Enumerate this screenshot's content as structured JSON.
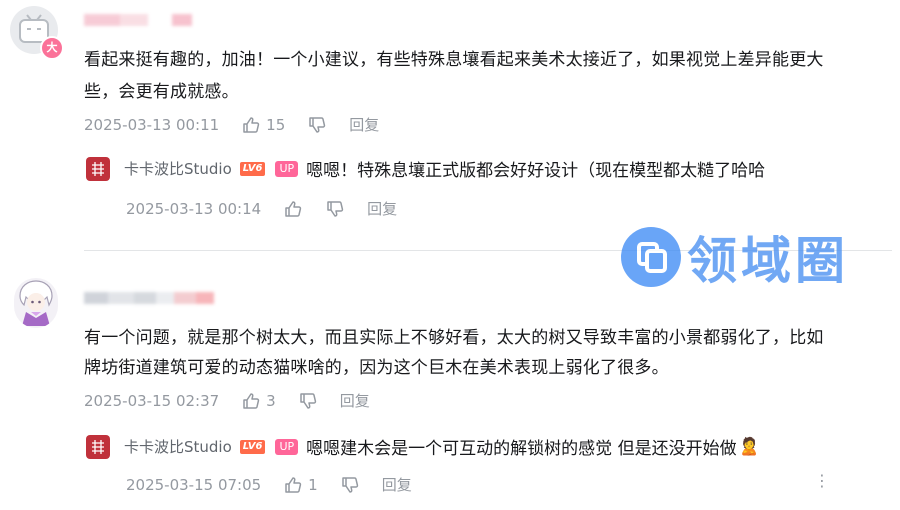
{
  "comments": [
    {
      "text_line1": "看起来挺有趣的，加油！一个小建议，有些特殊息壤看起来美术太接近了，如果视觉上差异能更大",
      "text_line2": "些，会更有成就感。",
      "time": "2025-03-13 00:11",
      "likes": "15",
      "reply_label": "回复",
      "avatar_badge": "大",
      "reply": {
        "author": "卡卡波比Studio",
        "level": "LV6",
        "up_badge": "UP",
        "text": "嗯嗯！特殊息壤正式版都会好好设计（现在模型都太糙了哈哈",
        "time": "2025-03-13 00:14",
        "likes": "",
        "reply_label": "回复"
      }
    },
    {
      "text_line1": "有一个问题，就是那个树太大，而且实际上不够好看，太大的树又导致丰富的小景都弱化了，比如",
      "text_line2": "牌坊街道建筑可爱的动态猫咪啥的，因为这个巨木在美术表现上弱化了很多。",
      "time": "2025-03-15 02:37",
      "likes": "3",
      "reply_label": "回复",
      "reply": {
        "author": "卡卡波比Studio",
        "level": "LV6",
        "up_badge": "UP",
        "text": "嗯嗯建木会是一个可互动的解锁树的感觉 但是还没开始做",
        "emoji": "🙎",
        "time": "2025-03-15 07:05",
        "likes": "1",
        "reply_label": "回复"
      }
    }
  ],
  "watermark": {
    "text": "领域圈"
  },
  "colors": {
    "accent_pink": "#ff6699",
    "level": "#ff6b4a",
    "meta_gray": "#9499a0",
    "watermark_blue": "#4a90f2"
  },
  "icons": [
    "thumb-up-icon",
    "thumb-down-icon",
    "more-vertical-icon"
  ]
}
